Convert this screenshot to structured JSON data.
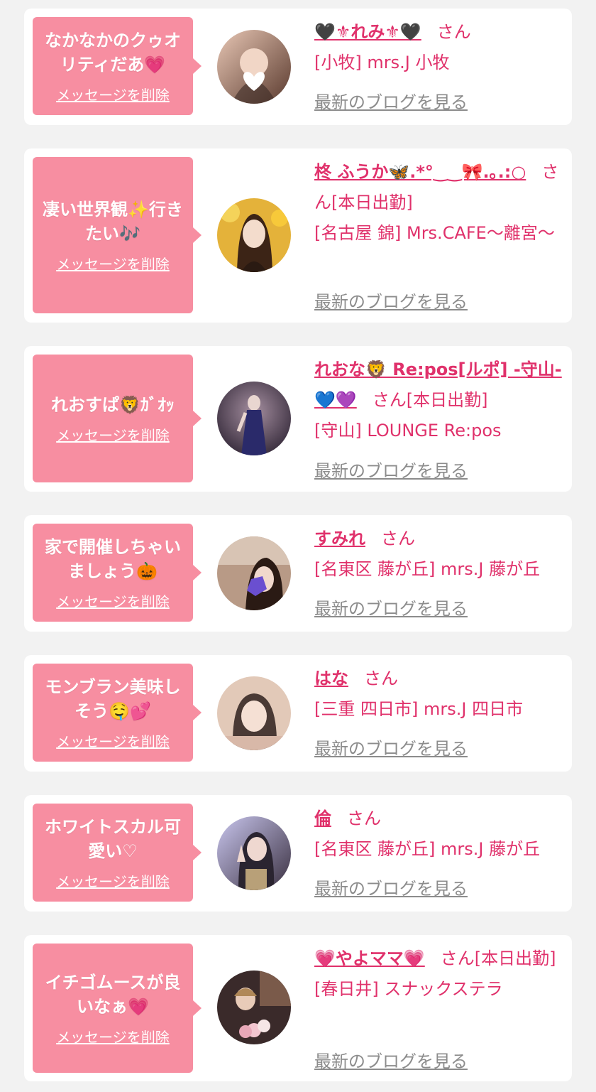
{
  "cards": [
    {
      "message": "なかなかのクゥオリティだあ💗",
      "delete_label": "メッセージを削除",
      "name": "🖤⚜れみ⚜🖤",
      "suffix": "さん",
      "status": "",
      "shop": "[小牧] mrs.J 小牧",
      "blog_label": "最新のブログを見る",
      "avatar_colors": [
        "#d9b9a6",
        "#3b2a24"
      ]
    },
    {
      "message": "凄い世界観✨行きたい🎶",
      "delete_label": "メッセージを削除",
      "name": "柊 ふうか🦋.*°‿‿🎀.｡.:○",
      "suffix": "さ",
      "status": "ん[本日出勤]",
      "shop": "[名古屋 錦] Mrs.CAFE～離宮～",
      "blog_label": "最新のブログを見る",
      "avatar_colors": [
        "#e4b23a",
        "#5a3a1c"
      ]
    },
    {
      "message": "れおすぱ🦁ｶﾞｵｯ",
      "delete_label": "メッセージを削除",
      "name": "れおな🦁 Re:pos[ルポ] -守山-💙💜",
      "suffix": "さん",
      "status": "[本日出勤]",
      "shop": "[守山] LOUNGE Re:pos",
      "blog_label": "最新のブログを見る",
      "avatar_colors": [
        "#6e5a66",
        "#1f1830"
      ]
    },
    {
      "message": "家で開催しちゃいましょう🎃",
      "delete_label": "メッセージを削除",
      "name": "すみれ",
      "suffix": "さん",
      "status": "",
      "shop": "[名東区 藤が丘] mrs.J 藤が丘",
      "blog_label": "最新のブログを見る",
      "avatar_colors": [
        "#b89a86",
        "#6a4fd0"
      ]
    },
    {
      "message": "モンブラン美味しそう🤤💕",
      "delete_label": "メッセージを削除",
      "name": "はな",
      "suffix": "さん",
      "status": "",
      "shop": "[三重 四日市] mrs.J 四日市",
      "blog_label": "最新のブログを見る",
      "avatar_colors": [
        "#e2c9b8",
        "#4a3a35"
      ]
    },
    {
      "message": "ホワイトスカル可愛い♡",
      "delete_label": "メッセージを削除",
      "name": "倫",
      "suffix": "さん",
      "status": "",
      "shop": "[名東区 藤が丘] mrs.J 藤が丘",
      "blog_label": "最新のブログを見る",
      "avatar_colors": [
        "#b7b4d8",
        "#2a2430"
      ]
    },
    {
      "message": "イチゴムースが良いなぁ💗",
      "delete_label": "メッセージを削除",
      "name": "💗やよママ💗",
      "suffix": "さん",
      "status": "[本日出勤]",
      "shop": "[春日井] スナックステラ",
      "blog_label": "最新のブログを見る",
      "avatar_colors": [
        "#c9a58c",
        "#3a2a2a"
      ]
    }
  ]
}
